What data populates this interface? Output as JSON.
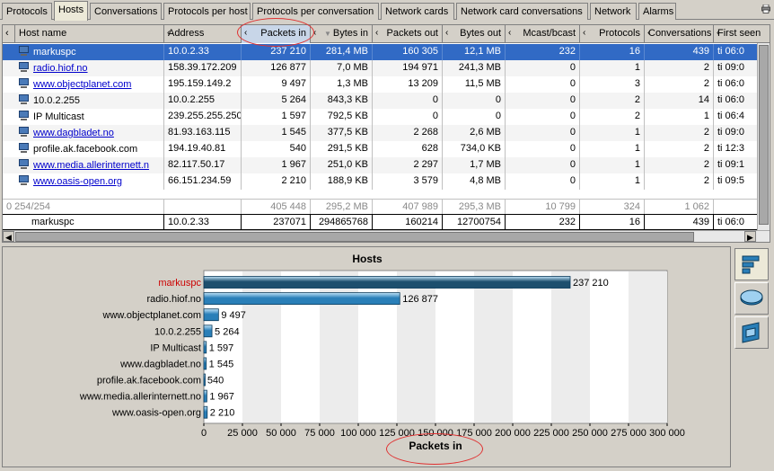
{
  "tabs": [
    "Protocols",
    "Hosts",
    "Conversations",
    "Protocols per host",
    "Protocols per conversation",
    "Network cards",
    "Network card conversations",
    "Network",
    "Alarms"
  ],
  "active_tab": "Hosts",
  "table": {
    "columns": [
      "Host name",
      "Address",
      "Packets in",
      "Bytes in",
      "Packets out",
      "Bytes out",
      "Mcast/bcast",
      "Protocols",
      "Conversations",
      "First seen"
    ],
    "rows": [
      {
        "host": "markuspc",
        "link": false,
        "address": "10.0.2.33",
        "packets_in": "237 210",
        "bytes_in": "281,4 MB",
        "packets_out": "160 305",
        "bytes_out": "12,1 MB",
        "mcast": "232",
        "protocols": "16",
        "conversations": "439",
        "first_seen": "ti 06:0"
      },
      {
        "host": "radio.hiof.no",
        "link": true,
        "address": "158.39.172.209",
        "packets_in": "126 877",
        "bytes_in": "7,0 MB",
        "packets_out": "194 971",
        "bytes_out": "241,3 MB",
        "mcast": "0",
        "protocols": "1",
        "conversations": "2",
        "first_seen": "ti 09:0"
      },
      {
        "host": "www.objectplanet.com",
        "link": true,
        "address": "195.159.149.2",
        "packets_in": "9 497",
        "bytes_in": "1,3 MB",
        "packets_out": "13 209",
        "bytes_out": "11,5 MB",
        "mcast": "0",
        "protocols": "3",
        "conversations": "2",
        "first_seen": "ti 06:0"
      },
      {
        "host": "10.0.2.255",
        "link": false,
        "address": "10.0.2.255",
        "packets_in": "5 264",
        "bytes_in": "843,3 KB",
        "packets_out": "0",
        "bytes_out": "0",
        "mcast": "0",
        "protocols": "2",
        "conversations": "14",
        "first_seen": "ti 06:0"
      },
      {
        "host": "IP Multicast",
        "link": false,
        "address": "239.255.255.250",
        "packets_in": "1 597",
        "bytes_in": "792,5 KB",
        "packets_out": "0",
        "bytes_out": "0",
        "mcast": "0",
        "protocols": "2",
        "conversations": "1",
        "first_seen": "ti 06:4"
      },
      {
        "host": "www.dagbladet.no",
        "link": true,
        "address": "81.93.163.115",
        "packets_in": "1 545",
        "bytes_in": "377,5 KB",
        "packets_out": "2 268",
        "bytes_out": "2,6 MB",
        "mcast": "0",
        "protocols": "1",
        "conversations": "2",
        "first_seen": "ti 09:0"
      },
      {
        "host": "profile.ak.facebook.com",
        "link": false,
        "address": "194.19.40.81",
        "packets_in": "540",
        "bytes_in": "291,5 KB",
        "packets_out": "628",
        "bytes_out": "734,0 KB",
        "mcast": "0",
        "protocols": "1",
        "conversations": "2",
        "first_seen": "ti 12:3"
      },
      {
        "host": "www.media.allerinternett.n",
        "link": true,
        "address": "82.117.50.17",
        "packets_in": "1 967",
        "bytes_in": "251,0 KB",
        "packets_out": "2 297",
        "bytes_out": "1,7 MB",
        "mcast": "0",
        "protocols": "1",
        "conversations": "2",
        "first_seen": "ti 09:1"
      },
      {
        "host": "www.oasis-open.org",
        "link": true,
        "address": "66.151.234.59",
        "packets_in": "2 210",
        "bytes_in": "188,9 KB",
        "packets_out": "3 579",
        "bytes_out": "4,8 MB",
        "mcast": "0",
        "protocols": "1",
        "conversations": "2",
        "first_seen": "ti 09:5"
      }
    ],
    "summary": {
      "count": "0  254/254",
      "packets_in": "405 448",
      "bytes_in": "295,2 MB",
      "packets_out": "407 989",
      "bytes_out": "295,3 MB",
      "mcast": "10 799",
      "protocols": "324",
      "conversations": "1 062"
    },
    "selected": {
      "host": "markuspc",
      "address": "10.0.2.33",
      "packets_in": "237071",
      "bytes_in": "294865768",
      "packets_out": "160214",
      "bytes_out": "12700754",
      "mcast": "232",
      "protocols": "16",
      "conversations": "439",
      "first_seen": "ti 06:0"
    }
  },
  "chart_data": {
    "type": "bar",
    "title": "Hosts",
    "xlabel": "Packets in",
    "ylabel": "",
    "orientation": "horizontal",
    "categories": [
      "markuspc",
      "radio.hiof.no",
      "www.objectplanet.com",
      "10.0.2.255",
      "IP Multicast",
      "www.dagbladet.no",
      "profile.ak.facebook.com",
      "www.media.allerinternett.no",
      "www.oasis-open.org"
    ],
    "values": [
      237210,
      126877,
      9497,
      5264,
      1597,
      1545,
      540,
      1967,
      2210
    ],
    "value_labels": [
      "237 210",
      "126 877",
      "9 497",
      "5 264",
      "1 597",
      "1 545",
      "540",
      "1 967",
      "2 210"
    ],
    "tick_labels": [
      "0",
      "25 000",
      "50 000",
      "75 000",
      "100 000",
      "125 000",
      "150 000",
      "175 000",
      "200 000",
      "225 000",
      "250 000",
      "275 000",
      "300 000"
    ],
    "xlim": [
      0,
      300000
    ],
    "highlight_category": "markuspc",
    "highlight_color": "#cc0000",
    "bar_color": "#2a7fb8",
    "selected_bar_color": "#1d4f6e",
    "grid": true
  },
  "side_buttons": [
    "bar-chart-icon",
    "pie-chart-icon",
    "3d-chart-icon"
  ],
  "colors": {
    "selection": "#316ac5",
    "link": "#0000cc",
    "annotation": "#e03030"
  }
}
